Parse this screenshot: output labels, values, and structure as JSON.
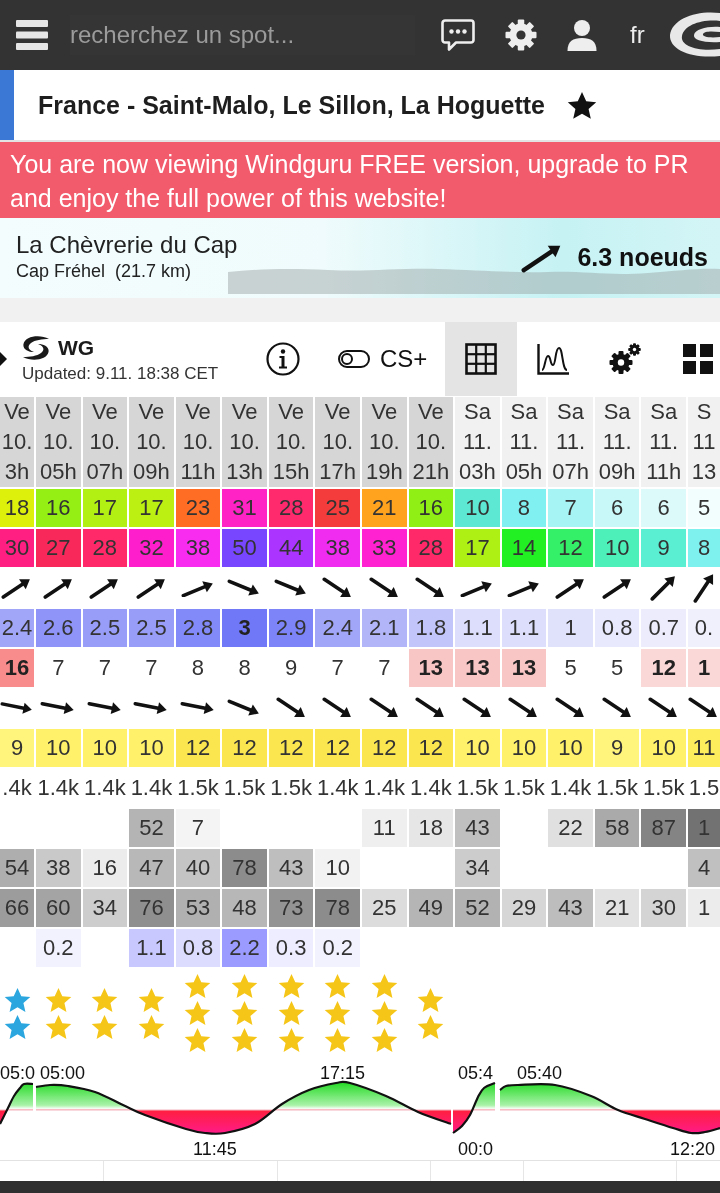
{
  "topbar": {
    "search": {
      "placeholder": "recherchez un spot..."
    },
    "language": "fr"
  },
  "spot": {
    "title": "France - Saint-Malo, Le Sillon, La Hoguette"
  },
  "banner": {
    "text": "You are now viewing Windguru FREE version, upgrade to PR\nand enjoy the full power of this website!"
  },
  "station": {
    "name": "La Chèvrerie du Cap",
    "place": "Cap Fréhel  (21.7 km)",
    "wind": "6.3 noeuds"
  },
  "toolbar": {
    "model": "WG",
    "updated": "Updated: 9.11. 18:38 CET",
    "toggle": {
      "label": "CS+",
      "on": false
    },
    "views": [
      {
        "kind": "table",
        "selected": true
      },
      {
        "kind": "chart",
        "selected": false
      }
    ]
  },
  "forecast": {
    "header": [
      {
        "day": "Ve",
        "date": "10.",
        "hour": "3h",
        "color": "#d6d6d6"
      },
      {
        "day": "Ve",
        "date": "10.",
        "hour": "05h",
        "color": "#d6d6d6"
      },
      {
        "day": "Ve",
        "date": "10.",
        "hour": "07h",
        "color": "#d6d6d6"
      },
      {
        "day": "Ve",
        "date": "10.",
        "hour": "09h",
        "color": "#d6d6d6"
      },
      {
        "day": "Ve",
        "date": "10.",
        "hour": "11h",
        "color": "#d6d6d6"
      },
      {
        "day": "Ve",
        "date": "10.",
        "hour": "13h",
        "color": "#d6d6d6"
      },
      {
        "day": "Ve",
        "date": "10.",
        "hour": "15h",
        "color": "#d6d6d6"
      },
      {
        "day": "Ve",
        "date": "10.",
        "hour": "17h",
        "color": "#d6d6d6"
      },
      {
        "day": "Ve",
        "date": "10.",
        "hour": "19h",
        "color": "#d6d6d6"
      },
      {
        "day": "Ve",
        "date": "10.",
        "hour": "21h",
        "color": "#d6d6d6"
      },
      {
        "day": "Sa",
        "date": "11.",
        "hour": "03h",
        "color": "#f1f1f1"
      },
      {
        "day": "Sa",
        "date": "11.",
        "hour": "05h",
        "color": "#f1f1f1"
      },
      {
        "day": "Sa",
        "date": "11.",
        "hour": "07h",
        "color": "#f1f1f1"
      },
      {
        "day": "Sa",
        "date": "11.",
        "hour": "09h",
        "color": "#f1f1f1"
      },
      {
        "day": "Sa",
        "date": "11.",
        "hour": "11h",
        "color": "#f1f1f1"
      },
      {
        "day": "S",
        "date": "11",
        "hour": "13",
        "color": "#f1f1f1"
      }
    ],
    "rows": [
      {
        "kind": "number",
        "cells": [
          {
            "text": "18",
            "color": "#dcf00c"
          },
          {
            "text": "16",
            "color": "#96ef14"
          },
          {
            "text": "17",
            "color": "#b2f014"
          },
          {
            "text": "17",
            "color": "#bcf012"
          },
          {
            "text": "23",
            "color": "#ff6c24"
          },
          {
            "text": "31",
            "color": "#ff22c4"
          },
          {
            "text": "28",
            "color": "#ff2a6e"
          },
          {
            "text": "25",
            "color": "#f53c3c"
          },
          {
            "text": "21",
            "color": "#ffa21e"
          },
          {
            "text": "16",
            "color": "#90ef14"
          },
          {
            "text": "10",
            "color": "#5ce8d2"
          },
          {
            "text": "8",
            "color": "#80f0f0"
          },
          {
            "text": "7",
            "color": "#a6f4f4"
          },
          {
            "text": "6",
            "color": "#c8f8f8"
          },
          {
            "text": "6",
            "color": "#dcfafa"
          },
          {
            "text": "5",
            "color": "#f2fdfd"
          }
        ]
      },
      {
        "kind": "number",
        "cells": [
          {
            "text": "30",
            "color": "#ff1e82"
          },
          {
            "text": "27",
            "color": "#f8285a"
          },
          {
            "text": "28",
            "color": "#ff2868"
          },
          {
            "text": "32",
            "color": "#ff1ecc"
          },
          {
            "text": "38",
            "color": "#f82cf0"
          },
          {
            "text": "50",
            "color": "#7846ff"
          },
          {
            "text": "44",
            "color": "#ac34ff"
          },
          {
            "text": "38",
            "color": "#f02cf0"
          },
          {
            "text": "33",
            "color": "#ff22d0"
          },
          {
            "text": "28",
            "color": "#ff2868"
          },
          {
            "text": "17",
            "color": "#aef014"
          },
          {
            "text": "14",
            "color": "#22f022"
          },
          {
            "text": "12",
            "color": "#34f068"
          },
          {
            "text": "10",
            "color": "#4ef0ba"
          },
          {
            "text": "9",
            "color": "#5aeed2"
          },
          {
            "text": "8",
            "color": "#7ef0ee"
          }
        ]
      },
      {
        "kind": "arrow",
        "cells": [
          {
            "kind": "nebe"
          },
          {
            "kind": "nebe"
          },
          {
            "kind": "nebe"
          },
          {
            "kind": "nebe"
          },
          {
            "kind": "ene"
          },
          {
            "kind": "ese"
          },
          {
            "kind": "ese"
          },
          {
            "kind": "sebe"
          },
          {
            "kind": "sebe"
          },
          {
            "kind": "sebe"
          },
          {
            "kind": "ene"
          },
          {
            "kind": "ene"
          },
          {
            "kind": "nebe"
          },
          {
            "kind": "nebe"
          },
          {
            "kind": "ne"
          },
          {
            "kind": "nebn"
          }
        ]
      },
      {
        "kind": "number",
        "cells": [
          {
            "text": "2.4",
            "color": "#a2a6f8",
            "bold": false
          },
          {
            "text": "2.6",
            "color": "#8e94f8",
            "bold": false
          },
          {
            "text": "2.5",
            "color": "#989df8",
            "bold": false
          },
          {
            "text": "2.5",
            "color": "#989df8",
            "bold": false
          },
          {
            "text": "2.8",
            "color": "#8289f8",
            "bold": false
          },
          {
            "text": "3",
            "color": "#7078f8",
            "bold": true
          },
          {
            "text": "2.9",
            "color": "#7c84f8",
            "bold": false
          },
          {
            "text": "2.4",
            "color": "#a2a6f8",
            "bold": false
          },
          {
            "text": "2.1",
            "color": "#b2b6f8",
            "bold": false
          },
          {
            "text": "1.8",
            "color": "#c2c5f9",
            "bold": false
          },
          {
            "text": "1.1",
            "color": "#dcdefb",
            "bold": false
          },
          {
            "text": "1.1",
            "color": "#dcdefb",
            "bold": false
          },
          {
            "text": "1",
            "color": "#e0e2fb",
            "bold": false
          },
          {
            "text": "0.8",
            "color": "#e8e9fc",
            "bold": false
          },
          {
            "text": "0.7",
            "color": "#ececfc",
            "bold": false
          },
          {
            "text": "0.",
            "color": "#f0f0fd",
            "bold": false
          }
        ]
      },
      {
        "kind": "number",
        "cells": [
          {
            "text": "16",
            "color": "#f88c8c",
            "bold": true
          },
          {
            "text": "7",
            "bold": false
          },
          {
            "text": "7",
            "bold": false
          },
          {
            "text": "7",
            "bold": false
          },
          {
            "text": "8",
            "bold": false
          },
          {
            "text": "8",
            "bold": false
          },
          {
            "text": "9",
            "bold": false
          },
          {
            "text": "7",
            "bold": false
          },
          {
            "text": "7",
            "bold": false
          },
          {
            "text": "13",
            "color": "#f9c6c6",
            "bold": true
          },
          {
            "text": "13",
            "color": "#f9c6c6",
            "bold": true
          },
          {
            "text": "13",
            "color": "#f9c6c6",
            "bold": true
          },
          {
            "text": "5",
            "bold": false
          },
          {
            "text": "5",
            "bold": false
          },
          {
            "text": "12",
            "color": "#fbd8d8",
            "bold": true
          },
          {
            "text": "1",
            "color": "#fbd8d8",
            "bold": true
          }
        ]
      },
      {
        "kind": "arrow",
        "cells": [
          {
            "kind": "ebs"
          },
          {
            "kind": "ebs"
          },
          {
            "kind": "ebs"
          },
          {
            "kind": "ebs"
          },
          {
            "kind": "ebs"
          },
          {
            "kind": "ese"
          },
          {
            "kind": "sebe"
          },
          {
            "kind": "sebe"
          },
          {
            "kind": "sebe"
          },
          {
            "kind": "sebe"
          },
          {
            "kind": "sebe"
          },
          {
            "kind": "sebe"
          },
          {
            "kind": "sebe"
          },
          {
            "kind": "sebe"
          },
          {
            "kind": "sebe"
          },
          {
            "kind": "sebe"
          }
        ]
      },
      {
        "kind": "number",
        "cells": [
          {
            "text": "9",
            "color": "#fff47c"
          },
          {
            "text": "10",
            "color": "#fff26a"
          },
          {
            "text": "10",
            "color": "#fff26a"
          },
          {
            "text": "10",
            "color": "#fff26a"
          },
          {
            "text": "12",
            "color": "#fbe650"
          },
          {
            "text": "12",
            "color": "#fbe650"
          },
          {
            "text": "12",
            "color": "#fbe650"
          },
          {
            "text": "12",
            "color": "#fbe650"
          },
          {
            "text": "12",
            "color": "#fbe650"
          },
          {
            "text": "12",
            "color": "#fbe650"
          },
          {
            "text": "10",
            "color": "#fff26a"
          },
          {
            "text": "10",
            "color": "#fff26a"
          },
          {
            "text": "10",
            "color": "#fff26a"
          },
          {
            "text": "9",
            "color": "#fff47c"
          },
          {
            "text": "10",
            "color": "#fff26a"
          },
          {
            "text": "11",
            "color": "#fdec5c"
          }
        ]
      },
      {
        "kind": "number",
        "cells": [
          {
            "text": ".4k"
          },
          {
            "text": "1.4k"
          },
          {
            "text": "1.4k"
          },
          {
            "text": "1.4k"
          },
          {
            "text": "1.5k"
          },
          {
            "text": "1.5k"
          },
          {
            "text": "1.5k"
          },
          {
            "text": "1.4k"
          },
          {
            "text": "1.4k"
          },
          {
            "text": "1.4k"
          },
          {
            "text": "1.5k"
          },
          {
            "text": "1.5k"
          },
          {
            "text": "1.4k"
          },
          {
            "text": "1.5k"
          },
          {
            "text": "1.5k"
          },
          {
            "text": "1.5"
          }
        ]
      },
      {
        "kind": "number",
        "cells": [
          null,
          null,
          null,
          {
            "text": "52",
            "color": "#b4b4b4"
          },
          {
            "text": "7",
            "color": "#f4f4f4"
          },
          null,
          null,
          null,
          {
            "text": "11",
            "color": "#efefef"
          },
          {
            "text": "18",
            "color": "#e6e6e6"
          },
          {
            "text": "43",
            "color": "#bfbfbf"
          },
          null,
          {
            "text": "22",
            "color": "#e0e0e0"
          },
          {
            "text": "58",
            "color": "#aaaaaa"
          },
          {
            "text": "87",
            "color": "#848484"
          },
          {
            "text": "1",
            "color": "#727272"
          }
        ]
      },
      {
        "kind": "number",
        "cells": [
          {
            "text": "54",
            "color": "#aeaeae"
          },
          {
            "text": "38",
            "color": "#c9c9c9"
          },
          {
            "text": "16",
            "color": "#ececec"
          },
          {
            "text": "47",
            "color": "#b8b8b8"
          },
          {
            "text": "40",
            "color": "#c4c4c4"
          },
          {
            "text": "78",
            "color": "#8c8c8c"
          },
          {
            "text": "43",
            "color": "#bebebe"
          },
          {
            "text": "10",
            "color": "#f2f2f2"
          },
          null,
          null,
          {
            "text": "34",
            "color": "#cccccc"
          },
          null,
          null,
          null,
          null,
          {
            "text": "4",
            "color": "#c0c0c0"
          }
        ]
      },
      {
        "kind": "number",
        "cells": [
          {
            "text": "66",
            "color": "#9c9c9c"
          },
          {
            "text": "60",
            "color": "#a4a4a4"
          },
          {
            "text": "34",
            "color": "#cdcdcd"
          },
          {
            "text": "76",
            "color": "#8f8f8f"
          },
          {
            "text": "53",
            "color": "#b0b0b0"
          },
          {
            "text": "48",
            "color": "#b7b7b7"
          },
          {
            "text": "73",
            "color": "#949494"
          },
          {
            "text": "78",
            "color": "#8c8c8c"
          },
          {
            "text": "25",
            "color": "#dcdcdc"
          },
          {
            "text": "49",
            "color": "#b5b5b5"
          },
          {
            "text": "52",
            "color": "#b2b2b2"
          },
          {
            "text": "29",
            "color": "#d6d6d6"
          },
          {
            "text": "43",
            "color": "#bdbdbd"
          },
          {
            "text": "21",
            "color": "#e2e2e2"
          },
          {
            "text": "30",
            "color": "#d4d4d4"
          },
          {
            "text": "1",
            "color": "#ececec"
          }
        ]
      },
      {
        "kind": "number",
        "cells": [
          null,
          {
            "text": "0.2",
            "color": "#f2f2ff"
          },
          null,
          {
            "text": "1.1",
            "color": "#c8c8ff"
          },
          {
            "text": "0.8",
            "color": "#dcdcff"
          },
          {
            "text": "2.2",
            "color": "#9a9aff"
          },
          {
            "text": "0.3",
            "color": "#ededff"
          },
          {
            "text": "0.2",
            "color": "#f2f2ff"
          },
          null,
          null,
          null,
          null,
          null,
          null,
          null,
          null
        ]
      },
      {
        "kind": "stars",
        "cells": [
          {
            "rating": [
              {
                "color": "#2ba6de"
              },
              {
                "color": "#2ba6de"
              }
            ]
          },
          {
            "rating": [
              {
                "color": "#f5c518"
              },
              {
                "color": "#f5c518"
              }
            ]
          },
          {
            "rating": [
              {
                "color": "#f5c518"
              },
              {
                "color": "#f5c518"
              }
            ]
          },
          {
            "rating": [
              {
                "color": "#f5c518"
              },
              {
                "color": "#f5c518"
              }
            ]
          },
          {
            "rating": [
              {
                "color": "#f5c518"
              },
              {
                "color": "#f5c518"
              },
              {
                "color": "#f5c518"
              }
            ]
          },
          {
            "rating": [
              {
                "color": "#f5c518"
              },
              {
                "color": "#f5c518"
              },
              {
                "color": "#f5c518"
              }
            ]
          },
          {
            "rating": [
              {
                "color": "#f5c518"
              },
              {
                "color": "#f5c518"
              },
              {
                "color": "#f5c518"
              }
            ]
          },
          {
            "rating": [
              {
                "color": "#f5c518"
              },
              {
                "color": "#f5c518"
              },
              {
                "color": "#f5c518"
              }
            ]
          },
          {
            "rating": [
              {
                "color": "#f5c518"
              },
              {
                "color": "#f5c518"
              },
              {
                "color": "#f5c518"
              }
            ]
          },
          {
            "rating": [
              {
                "color": "#f5c518"
              },
              {
                "color": "#f5c518"
              }
            ]
          },
          null,
          null,
          null,
          null,
          null,
          null
        ]
      }
    ]
  },
  "tide": {
    "labels": [
      {
        "text": "05:0",
        "kind": "high"
      },
      {
        "text": "05:00",
        "kind": "high"
      },
      {
        "text": "11:45",
        "kind": "low"
      },
      {
        "text": "17:15",
        "kind": "high"
      },
      {
        "text": "05:4",
        "kind": "high"
      },
      {
        "text": "00:0",
        "kind": "low"
      },
      {
        "text": "05:40",
        "kind": "high"
      },
      {
        "text": "12:20",
        "kind": "low"
      }
    ]
  }
}
